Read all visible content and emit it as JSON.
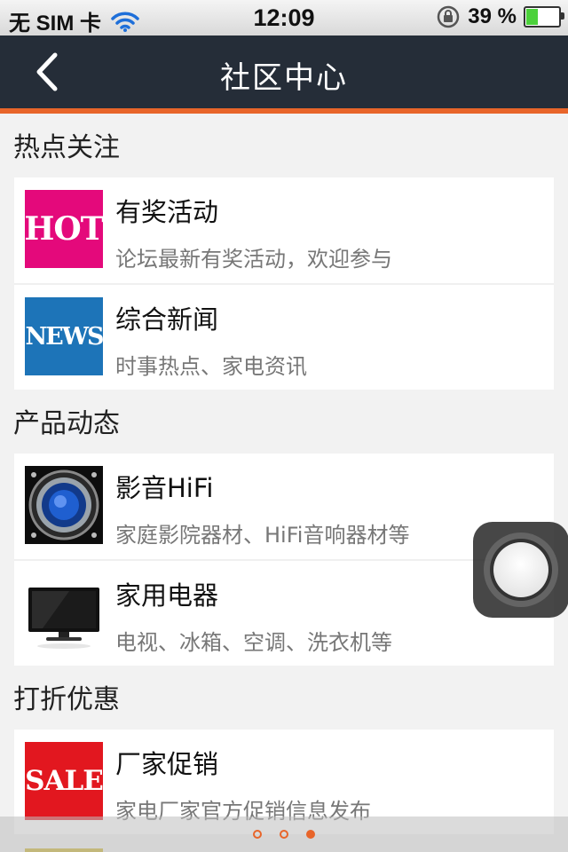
{
  "status_bar": {
    "carrier": "无 SIM 卡",
    "time": "12:09",
    "battery": "39 %",
    "battery_level": 0.39
  },
  "nav": {
    "title": "社区中心",
    "back_icon": "chevron-left-icon"
  },
  "sections": [
    {
      "title": "热点关注",
      "items": [
        {
          "title": "有奖活动",
          "subtitle": "论坛最新有奖活动，欢迎参与",
          "thumb_text": "HOT",
          "thumb_color": "#e4097b"
        },
        {
          "title": "综合新闻",
          "subtitle": "时事热点、家电资讯",
          "thumb_text": "NEWS",
          "thumb_color": "#1d74b8"
        }
      ]
    },
    {
      "title": "产品动态",
      "items": [
        {
          "title": "影音HiFi",
          "subtitle": "家庭影院器材、HiFi音响器材等",
          "thumb_icon": "speaker-icon"
        },
        {
          "title": "家用电器",
          "subtitle": "电视、冰箱、空调、洗衣机等",
          "thumb_icon": "tv-icon"
        }
      ]
    },
    {
      "title": "打折优惠",
      "items": [
        {
          "title": "厂家促销",
          "subtitle": "家电厂家官方促销信息发布",
          "thumb_text": "SALE",
          "thumb_color": "#e2171f"
        }
      ]
    }
  ],
  "pager": {
    "count": 3,
    "active_index": 2
  },
  "colors": {
    "accent": "#e8652a",
    "nav_bg": "#252d38"
  }
}
